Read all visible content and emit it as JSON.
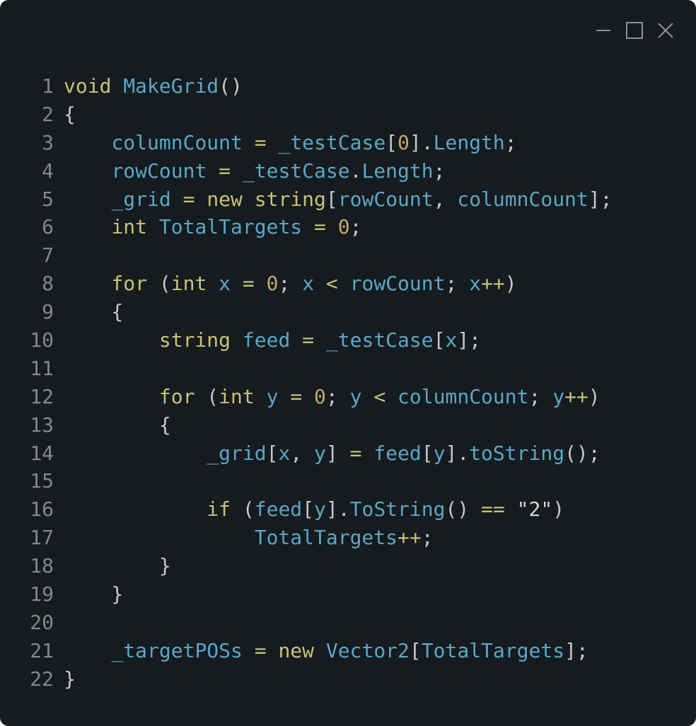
{
  "window": {
    "controls": {
      "minimize_icon": "minimize-icon",
      "maximize_icon": "maximize-icon",
      "close_icon": "close-icon"
    }
  },
  "colors": {
    "background": "#151b1e",
    "line_number": "#7e8a8c",
    "keyword": "#c9c27a",
    "identifier": "#5aa7c8",
    "number": "#c8a86b",
    "punctuation": "#c7c7c7"
  },
  "code": {
    "lines": [
      {
        "n": "1",
        "tokens": [
          [
            "kw",
            "void"
          ],
          [
            "pun",
            " "
          ],
          [
            "fn",
            "MakeGrid"
          ],
          [
            "pun",
            "()"
          ]
        ]
      },
      {
        "n": "2",
        "tokens": [
          [
            "pun",
            "{"
          ]
        ]
      },
      {
        "n": "3",
        "tokens": [
          [
            "pun",
            "    "
          ],
          [
            "id",
            "columnCount"
          ],
          [
            "pun",
            " "
          ],
          [
            "op",
            "="
          ],
          [
            "pun",
            " "
          ],
          [
            "id",
            "_testCase"
          ],
          [
            "pun",
            "["
          ],
          [
            "num",
            "0"
          ],
          [
            "pun",
            "]."
          ],
          [
            "id",
            "Length"
          ],
          [
            "pun",
            ";"
          ]
        ]
      },
      {
        "n": "4",
        "tokens": [
          [
            "pun",
            "    "
          ],
          [
            "id",
            "rowCount"
          ],
          [
            "pun",
            " "
          ],
          [
            "op",
            "="
          ],
          [
            "pun",
            " "
          ],
          [
            "id",
            "_testCase"
          ],
          [
            "pun",
            "."
          ],
          [
            "id",
            "Length"
          ],
          [
            "pun",
            ";"
          ]
        ]
      },
      {
        "n": "5",
        "tokens": [
          [
            "pun",
            "    "
          ],
          [
            "id",
            "_grid"
          ],
          [
            "pun",
            " "
          ],
          [
            "op",
            "="
          ],
          [
            "pun",
            " "
          ],
          [
            "kw",
            "new"
          ],
          [
            "pun",
            " "
          ],
          [
            "type",
            "string"
          ],
          [
            "pun",
            "["
          ],
          [
            "id",
            "rowCount"
          ],
          [
            "pun",
            ", "
          ],
          [
            "id",
            "columnCount"
          ],
          [
            "pun",
            "];"
          ]
        ]
      },
      {
        "n": "6",
        "tokens": [
          [
            "pun",
            "    "
          ],
          [
            "type",
            "int"
          ],
          [
            "pun",
            " "
          ],
          [
            "id",
            "TotalTargets"
          ],
          [
            "pun",
            " "
          ],
          [
            "op",
            "="
          ],
          [
            "pun",
            " "
          ],
          [
            "num",
            "0"
          ],
          [
            "pun",
            ";"
          ]
        ]
      },
      {
        "n": "7",
        "tokens": [
          [
            "pun",
            ""
          ]
        ]
      },
      {
        "n": "8",
        "tokens": [
          [
            "pun",
            "    "
          ],
          [
            "kw",
            "for"
          ],
          [
            "pun",
            " ("
          ],
          [
            "type",
            "int"
          ],
          [
            "pun",
            " "
          ],
          [
            "id",
            "x"
          ],
          [
            "pun",
            " "
          ],
          [
            "op",
            "="
          ],
          [
            "pun",
            " "
          ],
          [
            "num",
            "0"
          ],
          [
            "pun",
            "; "
          ],
          [
            "id",
            "x"
          ],
          [
            "pun",
            " "
          ],
          [
            "op",
            "<"
          ],
          [
            "pun",
            " "
          ],
          [
            "id",
            "rowCount"
          ],
          [
            "pun",
            "; "
          ],
          [
            "id",
            "x"
          ],
          [
            "op",
            "++"
          ],
          [
            "pun",
            ")"
          ]
        ]
      },
      {
        "n": "9",
        "tokens": [
          [
            "pun",
            "    {"
          ]
        ]
      },
      {
        "n": "10",
        "tokens": [
          [
            "pun",
            "        "
          ],
          [
            "type",
            "string"
          ],
          [
            "pun",
            " "
          ],
          [
            "id",
            "feed"
          ],
          [
            "pun",
            " "
          ],
          [
            "op",
            "="
          ],
          [
            "pun",
            " "
          ],
          [
            "id",
            "_testCase"
          ],
          [
            "pun",
            "["
          ],
          [
            "id",
            "x"
          ],
          [
            "pun",
            "];"
          ]
        ]
      },
      {
        "n": "11",
        "tokens": [
          [
            "pun",
            ""
          ]
        ]
      },
      {
        "n": "12",
        "tokens": [
          [
            "pun",
            "        "
          ],
          [
            "kw",
            "for"
          ],
          [
            "pun",
            " ("
          ],
          [
            "type",
            "int"
          ],
          [
            "pun",
            " "
          ],
          [
            "id",
            "y"
          ],
          [
            "pun",
            " "
          ],
          [
            "op",
            "="
          ],
          [
            "pun",
            " "
          ],
          [
            "num",
            "0"
          ],
          [
            "pun",
            "; "
          ],
          [
            "id",
            "y"
          ],
          [
            "pun",
            " "
          ],
          [
            "op",
            "<"
          ],
          [
            "pun",
            " "
          ],
          [
            "id",
            "columnCount"
          ],
          [
            "pun",
            "; "
          ],
          [
            "id",
            "y"
          ],
          [
            "op",
            "++"
          ],
          [
            "pun",
            ")"
          ]
        ]
      },
      {
        "n": "13",
        "tokens": [
          [
            "pun",
            "        {"
          ]
        ]
      },
      {
        "n": "14",
        "tokens": [
          [
            "pun",
            "            "
          ],
          [
            "id",
            "_grid"
          ],
          [
            "pun",
            "["
          ],
          [
            "id",
            "x"
          ],
          [
            "pun",
            ", "
          ],
          [
            "id",
            "y"
          ],
          [
            "pun",
            "] "
          ],
          [
            "op",
            "="
          ],
          [
            "pun",
            " "
          ],
          [
            "id",
            "feed"
          ],
          [
            "pun",
            "["
          ],
          [
            "id",
            "y"
          ],
          [
            "pun",
            "]."
          ],
          [
            "fn",
            "toString"
          ],
          [
            "pun",
            "();"
          ]
        ]
      },
      {
        "n": "15",
        "tokens": [
          [
            "pun",
            ""
          ]
        ]
      },
      {
        "n": "16",
        "tokens": [
          [
            "pun",
            "            "
          ],
          [
            "kw",
            "if"
          ],
          [
            "pun",
            " ("
          ],
          [
            "id",
            "feed"
          ],
          [
            "pun",
            "["
          ],
          [
            "id",
            "y"
          ],
          [
            "pun",
            "]."
          ],
          [
            "fn",
            "ToString"
          ],
          [
            "pun",
            "() "
          ],
          [
            "op",
            "=="
          ],
          [
            "pun",
            " "
          ],
          [
            "str",
            "\"2\""
          ],
          [
            "pun",
            ")"
          ]
        ]
      },
      {
        "n": "17",
        "tokens": [
          [
            "pun",
            "                "
          ],
          [
            "id",
            "TotalTargets"
          ],
          [
            "op",
            "++"
          ],
          [
            "pun",
            ";"
          ]
        ]
      },
      {
        "n": "18",
        "tokens": [
          [
            "pun",
            "        }"
          ]
        ]
      },
      {
        "n": "19",
        "tokens": [
          [
            "pun",
            "    }"
          ]
        ]
      },
      {
        "n": "20",
        "tokens": [
          [
            "pun",
            ""
          ]
        ]
      },
      {
        "n": "21",
        "tokens": [
          [
            "pun",
            "    "
          ],
          [
            "id",
            "_targetPOSs"
          ],
          [
            "pun",
            " "
          ],
          [
            "op",
            "="
          ],
          [
            "pun",
            " "
          ],
          [
            "kw",
            "new"
          ],
          [
            "pun",
            " "
          ],
          [
            "id",
            "Vector2"
          ],
          [
            "pun",
            "["
          ],
          [
            "id",
            "TotalTargets"
          ],
          [
            "pun",
            "];"
          ]
        ]
      },
      {
        "n": "22",
        "tokens": [
          [
            "pun",
            "}"
          ]
        ]
      }
    ]
  }
}
